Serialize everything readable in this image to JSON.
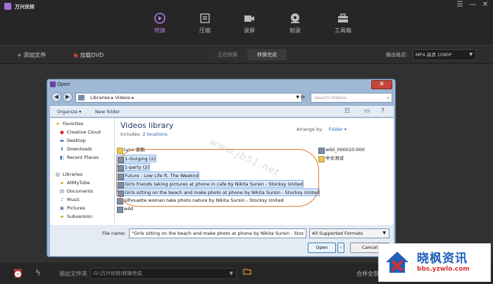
{
  "app": {
    "title": "万兴优转",
    "window_controls": [
      "☰",
      "—",
      "✕"
    ],
    "nav_tabs": [
      {
        "label": "转换",
        "icon": "play-circle-icon",
        "active": true
      },
      {
        "label": "压缩",
        "icon": "compress-icon",
        "active": false
      },
      {
        "label": "录屏",
        "icon": "camera-icon",
        "active": false
      },
      {
        "label": "刻录",
        "icon": "disc-icon",
        "active": false
      },
      {
        "label": "工具箱",
        "icon": "toolbox-icon",
        "active": false
      }
    ],
    "accent_color": "#b27de6"
  },
  "toolbar": {
    "add_files": "+ 添加文件",
    "load_dvd": "加载DVD",
    "seg_converting": "正在转换",
    "seg_done": "转换完成",
    "output_format_label": "输出格式:",
    "output_format_value": "MP4 高清 1080P"
  },
  "bottombar": {
    "output_folder_label": "输出文件夹",
    "output_path": "G:\\万兴优转\\转换完成",
    "merge_label": "合并全部"
  },
  "dialog": {
    "title": "Open",
    "breadcrumb": "Libraries  ▸  Videos  ▸",
    "search_placeholder": "Search Videos",
    "commands": {
      "organize": "Organize ▾",
      "new_folder": "New folder"
    },
    "nav_items": [
      {
        "label": "Favorites",
        "icon": "star-icon"
      },
      {
        "label": "Creative Cloud",
        "icon": "cloud-icon"
      },
      {
        "label": "Desktop",
        "icon": "desktop-icon"
      },
      {
        "label": "Downloads",
        "icon": "downloads-icon"
      },
      {
        "label": "Recent Places",
        "icon": "recent-icon"
      },
      {
        "label": "Libraries",
        "icon": "library-icon"
      },
      {
        "label": "AllMyTube",
        "icon": "folder-icon"
      },
      {
        "label": "Documents",
        "icon": "documents-icon"
      },
      {
        "label": "Music",
        "icon": "music-icon"
      },
      {
        "label": "Pictures",
        "icon": "pictures-icon"
      },
      {
        "label": "Subversion",
        "icon": "folder-icon"
      }
    ],
    "library_title": "Videos library",
    "library_includes": "Includes:",
    "library_locations": "2 locations",
    "arrange_by_label": "Arrange by:",
    "arrange_by_value": "Folder ▾",
    "watermark": "www.jb51.net",
    "files": [
      {
        "name": "Lync 录制",
        "type": "folder",
        "selected": false
      },
      {
        "name": "1-Outging (2)",
        "type": "video",
        "selected": true
      },
      {
        "name": "1-party (2)",
        "type": "video",
        "selected": true
      },
      {
        "name": "Future - Low Life ft. The Weeknd",
        "type": "video",
        "selected": true
      },
      {
        "name": "Girls friends taking pictures at phone in cafe by Nikita Sursin - Stocksy United",
        "type": "video",
        "selected": true
      },
      {
        "name": "Girls sitting on the beach and make photo at phone by Nikita Sursin - Stocksy United",
        "type": "video",
        "selected": true
      },
      {
        "name": "silhouette woman take photo nature by Nikita Sursin - Stocksy United",
        "type": "video",
        "selected": false
      },
      {
        "name": "wild",
        "type": "video",
        "selected": false
      }
    ],
    "files_right": [
      {
        "name": "wild_000010-000",
        "type": "video"
      },
      {
        "name": "中文测试",
        "type": "video"
      }
    ],
    "file_name_label": "File name:",
    "file_name_value": "\"Girls sitting on the beach and make photo at phone by Nikita Sursin - Stoc",
    "file_type_value": "All Supported Formats",
    "open_label": "Open",
    "cancel_label": "Cancel"
  },
  "brand": {
    "title": "晓枫资讯",
    "url": "bbs.yzwlo.com"
  }
}
